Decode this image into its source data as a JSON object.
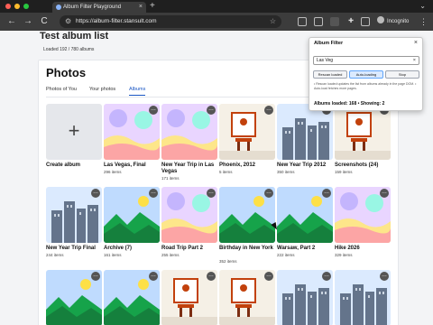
{
  "browser": {
    "tab_title": "Album Filter Playground",
    "tab_close": "×",
    "new_tab": "+",
    "tab_menu": "⌄",
    "url": "https://album-filter.stansult.com",
    "back": "←",
    "forward": "→",
    "reload": "C",
    "profile_label": "Incognito",
    "menu": "⋮",
    "traffic_colors": [
      "#ff5f57",
      "#febc2e",
      "#28c840"
    ]
  },
  "page": {
    "title": "Test album list",
    "loaded_line": "Loaded 192 / 780 albums"
  },
  "photos": {
    "title": "Photos",
    "tabs": [
      "Photos of You",
      "Your photos",
      "Albums"
    ],
    "active_tab": "Albums",
    "create_label": "Create album",
    "create_icon": "+",
    "albums": [
      {
        "name": "Las Vegas, Final",
        "count": "296 items",
        "art": "sunset"
      },
      {
        "name": "New Year Trip in Las Vegas",
        "count": "171 items",
        "art": "sunset"
      },
      {
        "name": "Phoenix, 2012",
        "count": "5 items",
        "art": "room"
      },
      {
        "name": "New Year Trip 2012",
        "count": "350 items",
        "art": "city"
      },
      {
        "name": "Screenshots (24)",
        "count": "159 items",
        "art": "room"
      },
      {
        "name": "New Year Trip Final",
        "count": "244 items",
        "art": "city"
      },
      {
        "name": "Archive (7)",
        "count": "161 items",
        "art": "mountain"
      },
      {
        "name": "Road Trip Part 2",
        "count": "255 items",
        "art": "sunset"
      },
      {
        "name": "Birthday in New York",
        "count": "352 items",
        "art": "mountain"
      },
      {
        "name": "Warsaw, Part 2",
        "count": "222 items",
        "art": "mountain"
      },
      {
        "name": "Hike 2026",
        "count": "329 items",
        "art": "sunset"
      },
      {
        "name": "",
        "count": "",
        "art": "mountain"
      },
      {
        "name": "",
        "count": "",
        "art": "mountain"
      },
      {
        "name": "",
        "count": "",
        "art": "room"
      },
      {
        "name": "",
        "count": "",
        "art": "room"
      },
      {
        "name": "",
        "count": "",
        "art": "city"
      },
      {
        "name": "",
        "count": "",
        "art": "city"
      }
    ]
  },
  "popup": {
    "title": "Album Filter",
    "close": "×",
    "input_value": "Las Veg",
    "input_clear": "×",
    "buttons": [
      "Rescan loaded",
      "Auto-loading",
      "Stop"
    ],
    "active_button": "Auto-loading",
    "note": "• Rescan loaded updates the list from albums already in the page DOM. • Auto-load fetches more pages.",
    "status": "Albums loaded: 168 • Showing: 2"
  }
}
